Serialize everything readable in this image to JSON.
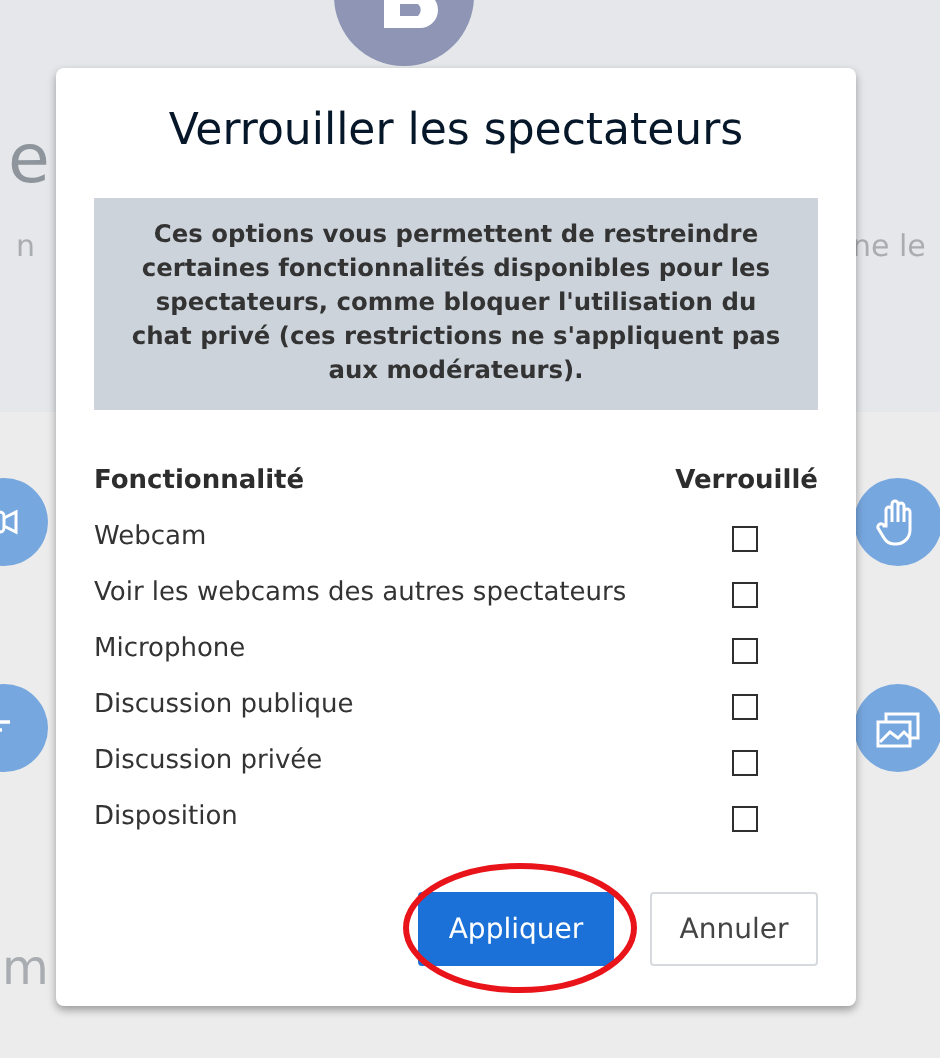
{
  "background": {
    "heading": "e",
    "texts": [
      "n",
      "ne le",
      "m"
    ]
  },
  "dialog": {
    "title": "Verrouiller les spectateurs",
    "info": "Ces options vous permettent de restreindre certaines fonctionnalités disponibles pour les spectateurs, comme bloquer l'utilisation du chat privé (ces restrictions ne s'appliquent pas aux modérateurs).",
    "columns": [
      "Fonctionnalité",
      "Verrouillé"
    ],
    "rows": [
      {
        "label": "Webcam",
        "checked": false
      },
      {
        "label": "Voir les webcams des autres spectateurs",
        "checked": false
      },
      {
        "label": "Microphone",
        "checked": false
      },
      {
        "label": "Discussion publique",
        "checked": false
      },
      {
        "label": "Discussion privée",
        "checked": false
      },
      {
        "label": "Disposition",
        "checked": false
      }
    ],
    "buttons": [
      {
        "label": "Appliquer",
        "kind": "primary",
        "highlighted": true
      },
      {
        "label": "Annuler",
        "kind": "secondary",
        "highlighted": false
      }
    ]
  }
}
